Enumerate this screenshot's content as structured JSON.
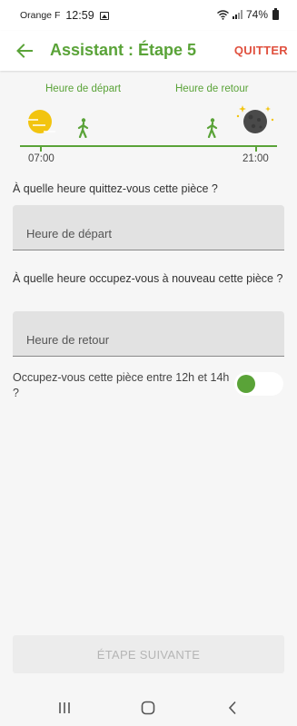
{
  "status_bar": {
    "carrier": "Orange F",
    "time": "12:59",
    "battery": "74%",
    "icons": [
      "gallery-icon",
      "wifi-icon",
      "signal-icon",
      "battery-icon"
    ]
  },
  "app_bar": {
    "title": "Assistant : Étape 5",
    "quit_label": "QUITTER",
    "accent_color": "#5aa338",
    "quit_color": "#e0513f"
  },
  "timeline": {
    "departure_label": "Heure de départ",
    "return_label": "Heure de retour",
    "start_time": "07:00",
    "end_time": "21:00",
    "icons": [
      "sun-icon",
      "walking-person-icon",
      "walking-person-icon",
      "moon-icon"
    ]
  },
  "form": {
    "departure_question": "À quelle heure quittez-vous cette pièce ?",
    "departure_placeholder": "Heure de départ",
    "return_question": "À quelle heure occupez-vous à nouveau cette pièce ?",
    "return_placeholder": "Heure de retour",
    "midday_question": "Occupez-vous cette pièce entre 12h et 14h ?",
    "midday_toggle_on": false
  },
  "footer": {
    "next_label": "ÉTAPE SUIVANTE"
  },
  "nav_bar": {
    "icons": [
      "recent-apps-icon",
      "home-icon",
      "back-icon"
    ]
  }
}
